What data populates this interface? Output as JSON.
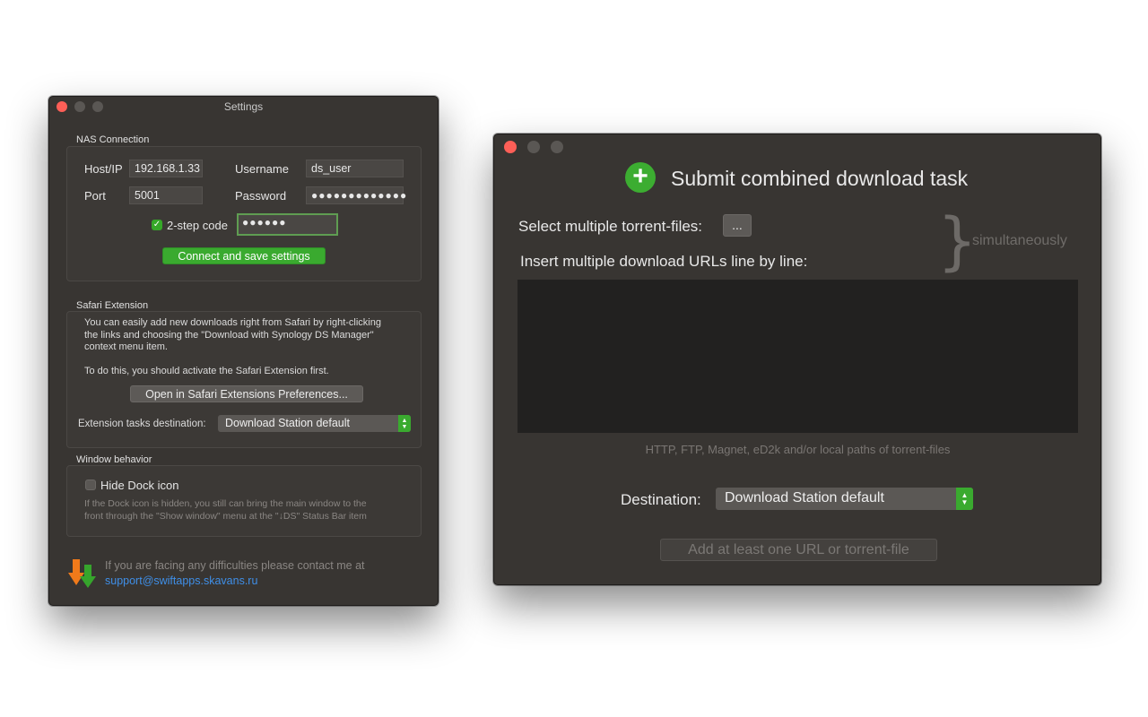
{
  "settings_window": {
    "title": "Settings",
    "nas": {
      "section": "NAS Connection",
      "host_label": "Host/IP",
      "host_value": "192.168.1.33",
      "username_label": "Username",
      "username_value": "ds_user",
      "port_label": "Port",
      "port_value": "5001",
      "password_label": "Password",
      "password_value": "●●●●●●●●●●●●●",
      "twostep_label": "2-step code",
      "twostep_checked": true,
      "twostep_value": "●●●●●●",
      "connect_button": "Connect and save settings"
    },
    "safari": {
      "section": "Safari Extension",
      "description_1": "You can easily add new downloads right from Safari by right-clicking",
      "description_2": "the links and choosing the \"Download with Synology DS Manager\"",
      "description_3": "context menu item.",
      "activate_note": "To do this, you should activate the Safari Extension first.",
      "open_button": "Open in Safari Extensions Preferences...",
      "destination_label": "Extension tasks destination:",
      "destination_value": "Download Station default"
    },
    "window_behavior": {
      "section": "Window behavior",
      "hide_dock_label": "Hide Dock icon",
      "hide_dock_checked": false,
      "note_1": "If the Dock icon is hidden, you still can bring the main window to the",
      "note_2": "front through the \"Show window\" menu at the \"↓DS\" Status Bar item"
    },
    "footer": {
      "contact_text": "If you are facing any difficulties please contact me at",
      "email": "support@swiftapps.skavans.ru"
    }
  },
  "submit_window": {
    "title": "Submit combined download task",
    "torrent_label": "Select multiple torrent-files:",
    "browse_button": "...",
    "urls_label": "Insert multiple download URLs line by line:",
    "simultaneously": "simultaneously",
    "urls_value": "",
    "hint": "HTTP, FTP, Magnet, eD2k and/or local paths of torrent-files",
    "destination_label": "Destination:",
    "destination_value": "Download Station default",
    "add_button": "Add at least one URL or torrent-file"
  },
  "colors": {
    "window_bg": "#383532",
    "accent_green": "#3aaa2f",
    "link_blue": "#3f8fe8",
    "close_red": "#fe5f57"
  }
}
